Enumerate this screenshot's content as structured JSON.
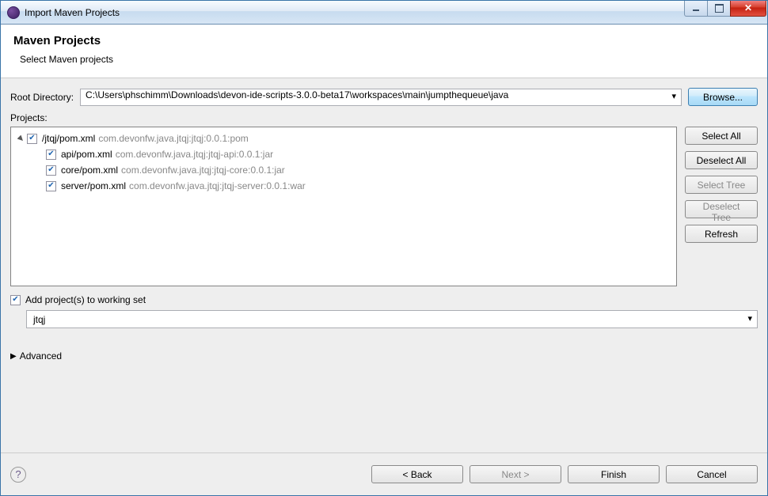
{
  "window": {
    "title": "Import Maven Projects"
  },
  "header": {
    "title": "Maven Projects",
    "subtitle": "Select Maven projects"
  },
  "rootDir": {
    "label": "Root Directory:",
    "value": "C:\\Users\\phschimm\\Downloads\\devon-ide-scripts-3.0.0-beta17\\workspaces\\main\\jumpthequeue\\java",
    "browse": "Browse..."
  },
  "projectsLabel": "Projects:",
  "tree": {
    "root": {
      "path": "/jtqj/pom.xml",
      "gav": "com.devonfw.java.jtqj:jtqj:0.0.1:pom",
      "checked": true
    },
    "children": [
      {
        "path": "api/pom.xml",
        "gav": "com.devonfw.java.jtqj:jtqj-api:0.0.1:jar",
        "checked": true
      },
      {
        "path": "core/pom.xml",
        "gav": "com.devonfw.java.jtqj:jtqj-core:0.0.1:jar",
        "checked": true
      },
      {
        "path": "server/pom.xml",
        "gav": "com.devonfw.java.jtqj:jtqj-server:0.0.1:war",
        "checked": true
      }
    ]
  },
  "sideButtons": {
    "selectAll": "Select All",
    "deselectAll": "Deselect All",
    "selectTree": "Select Tree",
    "deselectTree": "Deselect Tree",
    "refresh": "Refresh"
  },
  "workingSet": {
    "checked": true,
    "label": "Add project(s) to working set",
    "value": "jtqj"
  },
  "advanced": {
    "label": "Advanced"
  },
  "footer": {
    "back": "< Back",
    "next": "Next >",
    "finish": "Finish",
    "cancel": "Cancel"
  }
}
